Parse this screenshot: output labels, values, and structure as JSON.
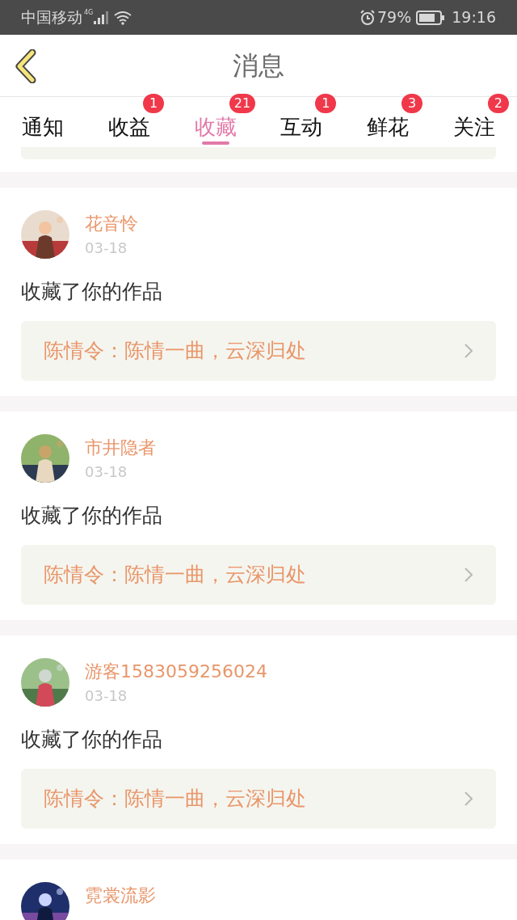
{
  "status_bar": {
    "carrier": "中国移动",
    "network": "4G",
    "battery": "79%",
    "time": "19:16"
  },
  "header": {
    "title": "消息"
  },
  "tabs": [
    {
      "label": "通知",
      "selected": false
    },
    {
      "label": "收益",
      "badge": "1",
      "selected": false
    },
    {
      "label": "收藏",
      "badge": "21",
      "selected": true
    },
    {
      "label": "互动",
      "badge": "1",
      "selected": false
    },
    {
      "label": "鲜花",
      "badge": "3",
      "selected": false
    },
    {
      "label": "关注",
      "badge": "2",
      "selected": false
    }
  ],
  "messages": [
    {
      "username": "花音怜",
      "date": "03-18",
      "action": "收藏了你的作品",
      "work": "陈情令：陈情一曲，云深归处"
    },
    {
      "username": "市井隐者",
      "date": "03-18",
      "action": "收藏了你的作品",
      "work": "陈情令：陈情一曲，云深归处"
    },
    {
      "username": "游客1583059256024",
      "date": "03-18",
      "action": "收藏了你的作品",
      "work": "陈情令：陈情一曲，云深归处"
    },
    {
      "username": "霓裳流影"
    }
  ]
}
